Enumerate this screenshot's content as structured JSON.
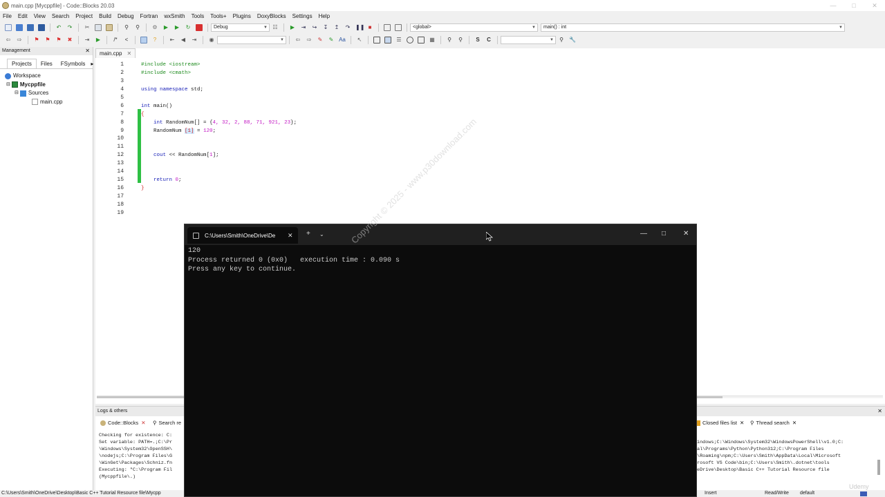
{
  "window": {
    "title": "main.cpp [Mycppfile] - Code::Blocks 20.03"
  },
  "menu": [
    "File",
    "Edit",
    "View",
    "Search",
    "Project",
    "Build",
    "Debug",
    "Fortran",
    "wxSmith",
    "Tools",
    "Tools+",
    "Plugins",
    "DoxyBlocks",
    "Settings",
    "Help"
  ],
  "toolbar": {
    "build_target": "Debug",
    "scope": "<global>",
    "symbol": "main() : int"
  },
  "management": {
    "title": "Management",
    "tabs": [
      "Projects",
      "Files",
      "FSymbols"
    ],
    "tree": {
      "workspace": "Workspace",
      "project": "Mycppfile",
      "folder": "Sources",
      "file": "main.cpp"
    }
  },
  "editor": {
    "tab": "main.cpp",
    "lines": [
      "1",
      "2",
      "3",
      "4",
      "5",
      "6",
      "7",
      "8",
      "9",
      "10",
      "11",
      "12",
      "13",
      "14",
      "15",
      "16",
      "17",
      "18",
      "19"
    ],
    "code": {
      "l1": "#include <iostream>",
      "l2": "#include <cmath>",
      "l4_kw": "using namespace",
      "l4_rest": " std;",
      "l6_kw": "int",
      "l6_rest": " main()",
      "l7": "{",
      "l8_kw": "int",
      "l8_name": " RandomNum[] = {",
      "l8_vals": "4, 32, 2, 88, 71, 921, 23",
      "l8_end": "};",
      "l9_name": "RandomNum ",
      "l9_idx": "[1]",
      "l9_eq": " = ",
      "l9_val": "120",
      "l9_end": ";",
      "l12_kw": "cout",
      "l12_rest": " << RandomNum[",
      "l12_idx": "1",
      "l12_end": "];",
      "l15_kw": "return",
      "l15_val": " 0",
      "l15_end": ";",
      "l16": "}"
    }
  },
  "logs": {
    "title": "Logs & others",
    "tab1": "Code::Blocks",
    "tab2": "Search re",
    "tab3": "Closed files list",
    "tab4": "Thread search",
    "left_text": "Checking for existence: C:\nSet variable: PATH=.;C:\\Pr\n\\Windows\\System32\\OpenSSH\\\n\\nodejs;C:\\Program Files\\G\n\\WinGet\\Packages\\Schniz.fn\nExecuting: \"C:\\Program Fil\n(Mycppfile\\.)",
    "right_text": "indows;C:\\Windows\\System32\\WindowsPowerShell\\v1.0;C:\nal\\Programs\\Python\\Python312;C:\\Program Files\n\\Roaming\\npm;C:\\Users\\Smith\\AppData\\Local\\Microsoft\nrosoft VS Code\\bin;C:\\Users\\Smith\\.dotnet\\tools\neDrive\\Desktop\\Basic C++ Tutorial Resource file"
  },
  "status": {
    "path": "C:\\Users\\Smith\\OneDrive\\Desktop\\Basic C++ Tutorial Resource file\\Mycpp",
    "mode": "Insert",
    "access": "Read/Write",
    "theme": "default"
  },
  "console": {
    "tab_title": "C:\\Users\\Smith\\OneDrive\\De",
    "output": [
      "120",
      "Process returned 0 (0x0)   execution time : 0.090 s",
      "Press any key to continue."
    ]
  },
  "watermark": "Copyright © 2025 - www.p30download.com",
  "udemy": "Udemy",
  "colors": {
    "changebar": "#2ec044",
    "keyword": "#1a22b8",
    "preprocessor": "#1c8a1c",
    "number": "#c31ac4",
    "console_bg": "#0c0c0c"
  }
}
